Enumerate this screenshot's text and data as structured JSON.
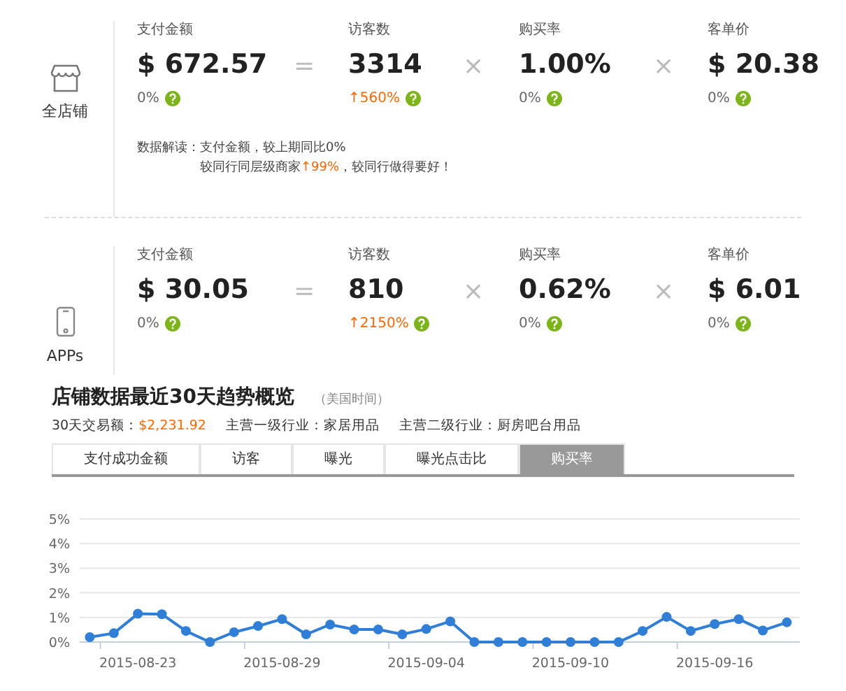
{
  "sections": [
    {
      "name": "全店铺",
      "interpretation": {
        "label": "数据解读：",
        "line1": "支付金额，较上期同比0%",
        "line2_before": "较同行同层级商家",
        "line2_highlight": "↑99%",
        "line2_after": "，较同行做得要好！"
      },
      "metrics": [
        {
          "label": "支付金额",
          "value": "$ 672.57",
          "change": "0%",
          "kind": "flat",
          "operator": "="
        },
        {
          "label": "访客数",
          "value": "3314",
          "change": "↑560%",
          "kind": "up",
          "operator": "×"
        },
        {
          "label": "购买率",
          "value": "1.00%",
          "change": "0%",
          "kind": "flat",
          "operator": "×"
        },
        {
          "label": "客单价",
          "value": "$ 20.38",
          "change": "0%",
          "kind": "flat"
        }
      ]
    },
    {
      "name": "APPs",
      "metrics": [
        {
          "label": "支付金额",
          "value": "$ 30.05",
          "change": "0%",
          "kind": "flat",
          "operator": "="
        },
        {
          "label": "访客数",
          "value": "810",
          "change": "↑2150%",
          "kind": "up",
          "operator": "×"
        },
        {
          "label": "购买率",
          "value": "0.62%",
          "change": "0%",
          "kind": "flat",
          "operator": "×"
        },
        {
          "label": "客单价",
          "value": "$ 6.01",
          "change": "0%",
          "kind": "flat"
        }
      ]
    }
  ],
  "trend": {
    "title": "店铺数据最近30天趋势概览",
    "subtitle": "（美国时间）",
    "info": [
      {
        "label": "30天交易额：",
        "value": "$2,231.92",
        "accent": true
      },
      {
        "label": "主营一级行业：",
        "value": "家居用品",
        "accent": false
      },
      {
        "label": "主营二级行业：",
        "value": "厨房吧台用品",
        "accent": false
      }
    ],
    "tabs": [
      {
        "label": "支付成功金额",
        "selected": false
      },
      {
        "label": "访客",
        "selected": false
      },
      {
        "label": "曝光",
        "selected": false
      },
      {
        "label": "曝光点击比",
        "selected": false
      },
      {
        "label": "购买率",
        "selected": true
      }
    ],
    "chart_data": {
      "type": "line",
      "categories": [
        null,
        null,
        "2015-08-23",
        null,
        null,
        null,
        null,
        null,
        "2015-08-29",
        null,
        null,
        null,
        null,
        null,
        "2015-09-04",
        null,
        null,
        null,
        null,
        null,
        "2015-09-10",
        null,
        null,
        null,
        null,
        null,
        "2015-09-16",
        null,
        null,
        null
      ],
      "grid": true,
      "series": [
        {
          "color": "#2f7ed8",
          "marker": true,
          "values": [
            0.2,
            0.36,
            1.15,
            1.13,
            0.45,
            0,
            0.4,
            0.65,
            0.93,
            0.31,
            0.71,
            0.51,
            0.51,
            0.31,
            0.53,
            0.84,
            0,
            0,
            0,
            0,
            0,
            0,
            0,
            0.45,
            1.02,
            0.45,
            0.73,
            0.93,
            0.47,
            0.8
          ]
        }
      ],
      "ylim": [
        0,
        5
      ],
      "yticks": [
        {
          "value": 0,
          "label": "0%"
        },
        {
          "value": 1,
          "label": "1%"
        },
        {
          "value": 2,
          "label": "2%"
        },
        {
          "value": 3,
          "label": "3%"
        },
        {
          "value": 4,
          "label": "4%"
        },
        {
          "value": 5,
          "label": "5%"
        }
      ]
    }
  }
}
